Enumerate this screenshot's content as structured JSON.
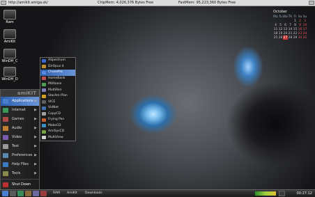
{
  "topbar": {
    "url": "http://amikit.amiga.sk/",
    "chipmem": "ChipMem: 4,026,376 Bytes Free",
    "fastmem": "FastMem: 95,223,360 Bytes Free"
  },
  "desktop_icons": [
    {
      "label": "Ram"
    },
    {
      "label": "AmiKit"
    },
    {
      "label": "WinDH_C"
    },
    {
      "label": "WinDH_D"
    }
  ],
  "calendar": {
    "month": "October",
    "days": [
      "Mo",
      "Tu",
      "We",
      "Th",
      "Fr",
      "Sa",
      "Su"
    ],
    "weeks": [
      [
        "",
        "",
        "",
        "",
        "1",
        "2",
        "3"
      ],
      [
        "4",
        "5",
        "6",
        "7",
        "8",
        "9",
        "10"
      ],
      [
        "11",
        "12",
        "13",
        "14",
        "15",
        "16",
        "17"
      ],
      [
        "18",
        "19",
        "20",
        "21",
        "22",
        "23",
        "24"
      ],
      [
        "25",
        "26",
        "27",
        "28",
        "29",
        "30",
        "31"
      ]
    ],
    "today": "27"
  },
  "start_menu": {
    "brand": "amiKIT",
    "items": [
      {
        "label": "Applications",
        "icon": "applications-icon",
        "color": "#4a7fd0",
        "has_sub": true,
        "selected": true
      },
      {
        "label": "Internet",
        "icon": "globe-icon",
        "color": "#3a9a5a",
        "has_sub": true
      },
      {
        "label": "Games",
        "icon": "gamepad-icon",
        "color": "#b04a4a",
        "has_sub": true
      },
      {
        "label": "Audio",
        "icon": "speaker-icon",
        "color": "#c08030",
        "has_sub": true
      },
      {
        "label": "Video",
        "icon": "film-icon",
        "color": "#7a5ab0",
        "has_sub": true
      },
      {
        "label": "Text",
        "icon": "text-icon",
        "color": "#9a9a9a",
        "has_sub": true
      },
      {
        "label": "Preferences",
        "icon": "gear-icon",
        "color": "#5a8ab0",
        "has_sub": true
      },
      {
        "label": "Help Files",
        "icon": "help-icon",
        "color": "#3a7ac0",
        "has_sub": true
      },
      {
        "label": "Tools",
        "icon": "tools-icon",
        "color": "#8a8a4a",
        "has_sub": true
      }
    ],
    "shutdown": {
      "label": "Shut Down",
      "icon": "power-icon",
      "color": "#c03030"
    }
  },
  "submenu": {
    "items": [
      {
        "label": "ASpectrum",
        "color": "#3a6ad0"
      },
      {
        "label": "DirOpus 4",
        "color": "#c09030"
      },
      {
        "label": "ChasePro",
        "color": "#5a8ae0",
        "selected": true
      },
      {
        "label": "HomeBank",
        "color": "#c05050"
      },
      {
        "label": "MUIbase",
        "color": "#50a050"
      },
      {
        "label": "MultiRen",
        "color": "#8080c0"
      },
      {
        "label": "StarAm Plan",
        "color": "#d0a020"
      },
      {
        "label": "VICE",
        "color": "#606060"
      },
      {
        "label": "VidNet",
        "color": "#4070b0"
      },
      {
        "label": "CopyCD",
        "color": "#a0a0a0"
      },
      {
        "label": "Frying Pan",
        "color": "#c06030"
      },
      {
        "label": "MakeCD",
        "color": "#3a90c0"
      },
      {
        "label": "AmiSysCD",
        "color": "#70a040"
      },
      {
        "label": "MultiView",
        "color": "#d0d0d0"
      }
    ]
  },
  "taskbar": {
    "items": [
      {
        "label": "RAM"
      },
      {
        "label": "AmiKit"
      },
      {
        "label": "Downloads"
      }
    ],
    "clock": "00:27:12"
  },
  "colors": {
    "accent": "#2d5fb0",
    "topbar_bg": "#dcdcdc",
    "menu_bg": "#1c1c1c"
  }
}
